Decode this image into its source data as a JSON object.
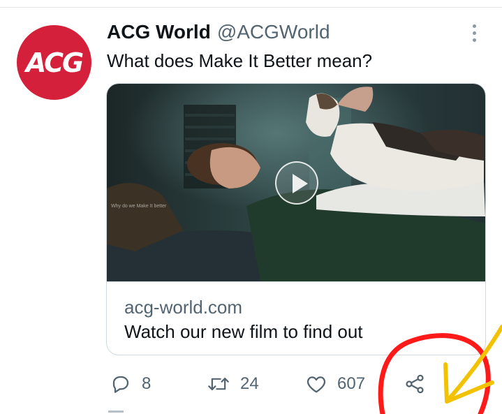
{
  "tweet": {
    "avatar_logo_text": "ACG",
    "display_name": "ACG World",
    "handle": "@ACGWorld",
    "text": "What does Make It Better mean?",
    "more_icon": "more-vertical-icon"
  },
  "card": {
    "video_caption": "Why do we Make It better",
    "domain": "acg-world.com",
    "title": "Watch our new film to find out",
    "play_icon": "play-icon"
  },
  "actions": {
    "reply_count": "8",
    "retweet_count": "24",
    "like_count": "607",
    "icons": [
      "reply-icon",
      "retweet-icon",
      "like-icon",
      "share-icon"
    ]
  },
  "colors": {
    "brand_red": "#d4203a",
    "text_primary": "#0f1419",
    "text_secondary": "#536471",
    "border": "#cfd9de",
    "annotation_red": "#ff1a1a",
    "annotation_yellow": "#f2c200"
  }
}
